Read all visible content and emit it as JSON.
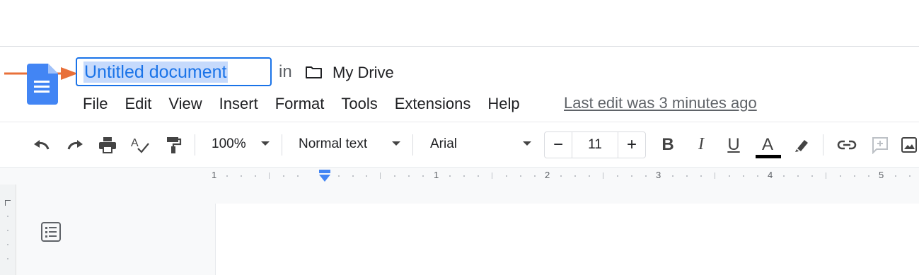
{
  "document": {
    "title": "Untitled document",
    "location_prefix": "in",
    "folder": "My Drive"
  },
  "menu": [
    "File",
    "Edit",
    "View",
    "Insert",
    "Format",
    "Tools",
    "Extensions",
    "Help"
  ],
  "status": {
    "last_edit": "Last edit was 3 minutes ago"
  },
  "toolbar": {
    "zoom": "100%",
    "style": "Normal text",
    "font": "Arial",
    "font_size": "11",
    "decrease_label": "−",
    "increase_label": "+",
    "bold": "B",
    "italic": "I",
    "underline": "U",
    "text_color": "A"
  },
  "ruler": {
    "labels": [
      "1",
      "1",
      "2",
      "3",
      "4",
      "5"
    ]
  },
  "colors": {
    "accent": "#1a73e8",
    "arrow": "#e8703a",
    "selection": "#c6dafc",
    "docs_blue": "#4285f4"
  }
}
